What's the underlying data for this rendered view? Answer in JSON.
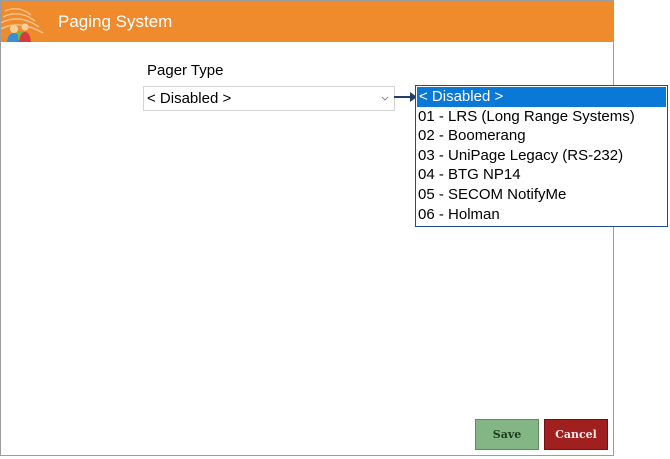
{
  "window": {
    "title": "Paging System"
  },
  "form": {
    "pager_type_label": "Pager Type",
    "pager_type_value": "< Disabled >"
  },
  "dropdown": {
    "options": [
      "< Disabled >",
      "01 - LRS (Long Range Systems)",
      "02 - Boomerang",
      "03 - UniPage Legacy (RS-232)",
      "04 - BTG NP14",
      "05 - SECOM NotifyMe",
      "06 - Holman"
    ],
    "selected_index": 0
  },
  "buttons": {
    "save_label": "Save",
    "cancel_label": "Cancel"
  },
  "colors": {
    "titlebar": "#ef8b2c",
    "selection": "#0a78d7",
    "save": "#83b684",
    "cancel": "#a01f1f"
  },
  "icons": {
    "app": "paging-signal-icon",
    "select": "chevron-down-icon",
    "callout": "arrow-right-icon"
  }
}
